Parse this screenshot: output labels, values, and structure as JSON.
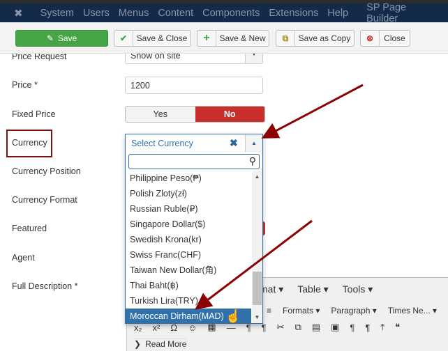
{
  "nav": {
    "items": [
      "System",
      "Users",
      "Menus",
      "Content",
      "Components",
      "Extensions",
      "Help",
      "SP Page Builder"
    ]
  },
  "toolbar": {
    "save": "Save",
    "save_close": "Save & Close",
    "save_new": "Save & New",
    "save_copy": "Save as Copy",
    "close": "Close"
  },
  "form": {
    "price_request_label": "Price Request",
    "price_request_value": "Show on site",
    "price_label": "Price *",
    "price_value": "1200",
    "fixed_price_label": "Fixed Price",
    "yes": "Yes",
    "no": "No",
    "currency_label": "Currency",
    "currency_position_label": "Currency Position",
    "currency_format_label": "Currency Format",
    "featured_label": "Featured",
    "agent_label": "Agent",
    "full_description_label": "Full Description *"
  },
  "currency_dropdown": {
    "placeholder": "Select Currency",
    "search_value": "",
    "options": [
      "Philippine Peso(₱)",
      "Polish Zloty(zł)",
      "Russian Ruble(₽)",
      "Singapore Dollar($)",
      "Swedish Krona(kr)",
      "Swiss Franc(CHF)",
      "Taiwan New Dollar(角)",
      "Thai Baht(฿)",
      "Turkish Lira(TRY)",
      "Moroccan Dirham(MAD)"
    ],
    "highlighted": "Moroccan Dirham(MAD)"
  },
  "editor": {
    "menu": [
      "mat ▾",
      "Table ▾",
      "Tools ▾"
    ],
    "formats": "Formats ▾",
    "paragraph": "Paragraph",
    "font": "Times Ne...",
    "read_more": "Read More"
  },
  "colors": {
    "nav": "#132a4b",
    "save": "#46a546",
    "no": "#c9302c",
    "accent": "#3071a9",
    "annotation": "#8b0000"
  }
}
